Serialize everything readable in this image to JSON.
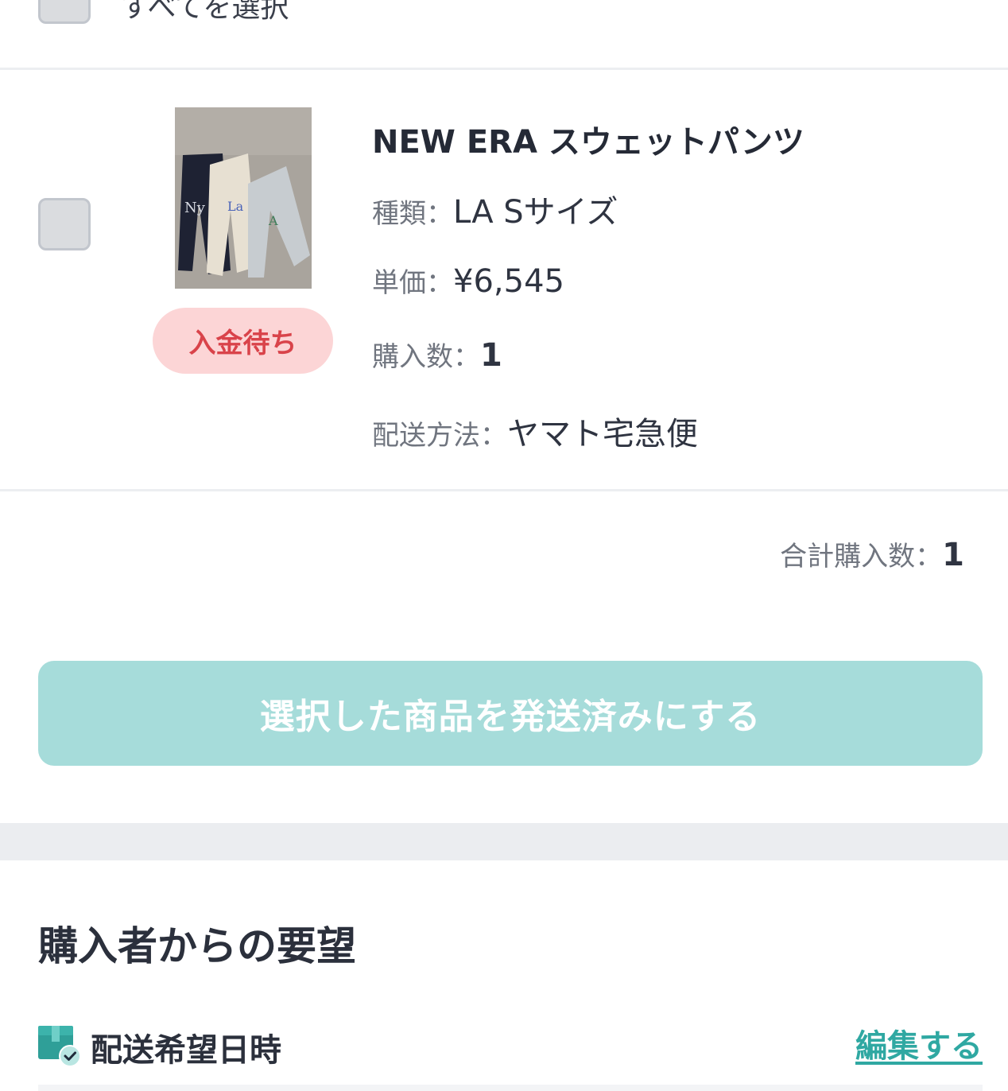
{
  "select_all": {
    "label": "すべてを選択",
    "checked": false
  },
  "item": {
    "checked": false,
    "title": "NEW ERA スウェットパンツ",
    "status": "入金待ち",
    "details": [
      {
        "label": "種類：",
        "value": "LA Sサイズ"
      },
      {
        "label": "単価：",
        "value": "¥6,545"
      },
      {
        "label": "購入数：",
        "value": "1"
      },
      {
        "label": "配送方法：",
        "value": "ヤマト宅急便"
      }
    ]
  },
  "summary": {
    "total_label": "合計購入数：",
    "total_value": "1"
  },
  "actions": {
    "ship_button_label": "選択した商品を発送済みにする"
  },
  "requests": {
    "title": "購入者からの要望",
    "delivery_label": "配送希望日時",
    "edit_label": "編集する"
  },
  "colors": {
    "accent": "#2fa8a2",
    "button_disabled": "#a6dcda",
    "status_bg": "#fcd5d6",
    "status_text": "#d9434a"
  }
}
